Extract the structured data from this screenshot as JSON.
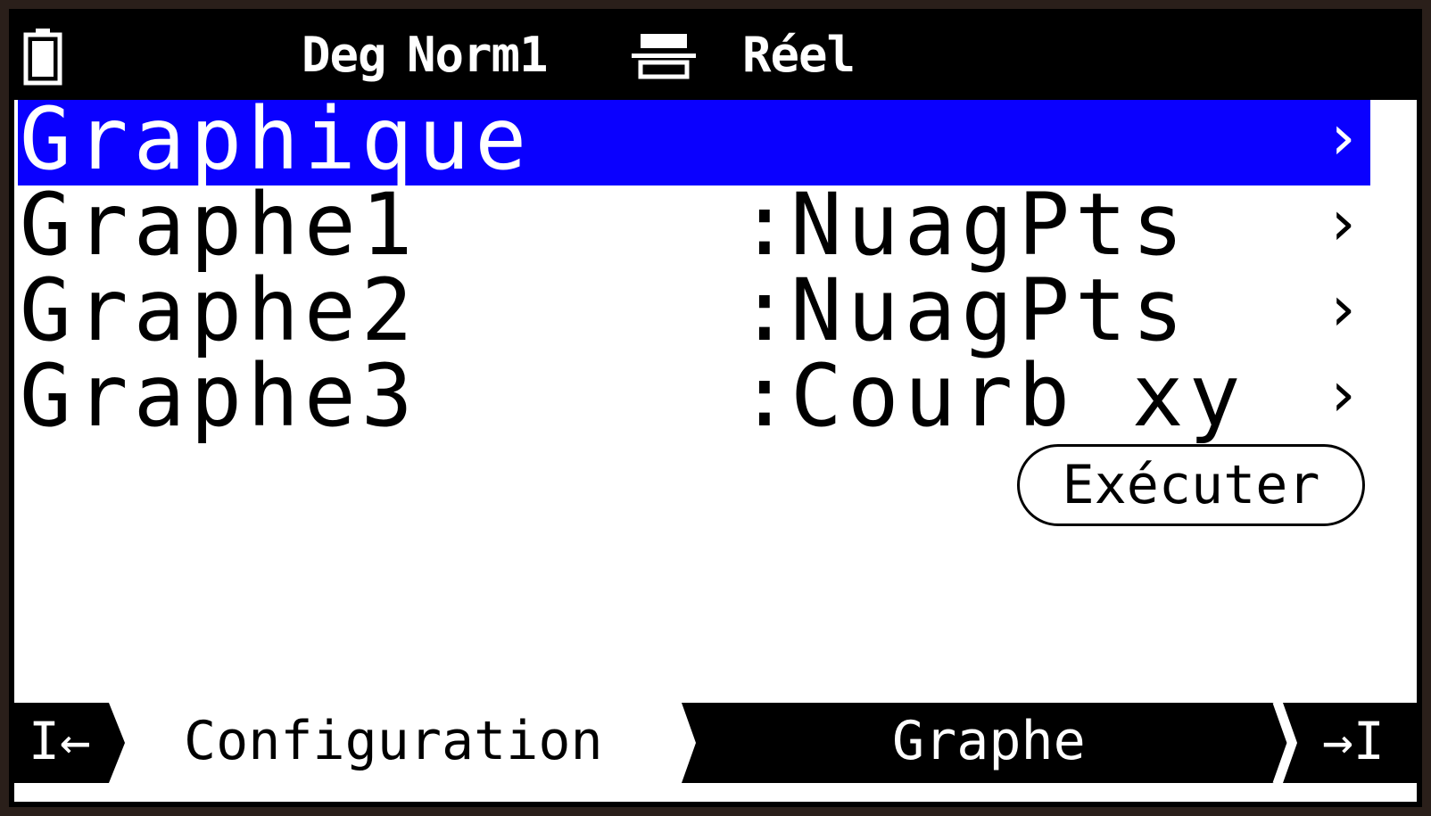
{
  "status_bar": {
    "angle_mode": "Deg",
    "display_format": "Norm1",
    "complex_mode": "Réel",
    "battery_icon": "battery-icon",
    "input_mode_icon": "input-mode-icon"
  },
  "menu": {
    "title": "Graphique",
    "title_chevron": "›",
    "rows": [
      {
        "label": "Graphe1",
        "separator": ":",
        "value": "NuagPts",
        "chevron": "›"
      },
      {
        "label": "Graphe2",
        "separator": ":",
        "value": "NuagPts",
        "chevron": "›"
      },
      {
        "label": "Graphe3",
        "separator": ":",
        "value": "Courb xy",
        "chevron": "›"
      }
    ]
  },
  "execute_button": {
    "label": "Exécuter"
  },
  "function_keys": {
    "left_icon": "I←",
    "config_label": "Configuration",
    "graphe_label": "Graphe",
    "right_icon": "→I"
  },
  "colors": {
    "selection": "#0a00ff",
    "statusbar_bg": "#000000",
    "background": "#ffffff"
  }
}
